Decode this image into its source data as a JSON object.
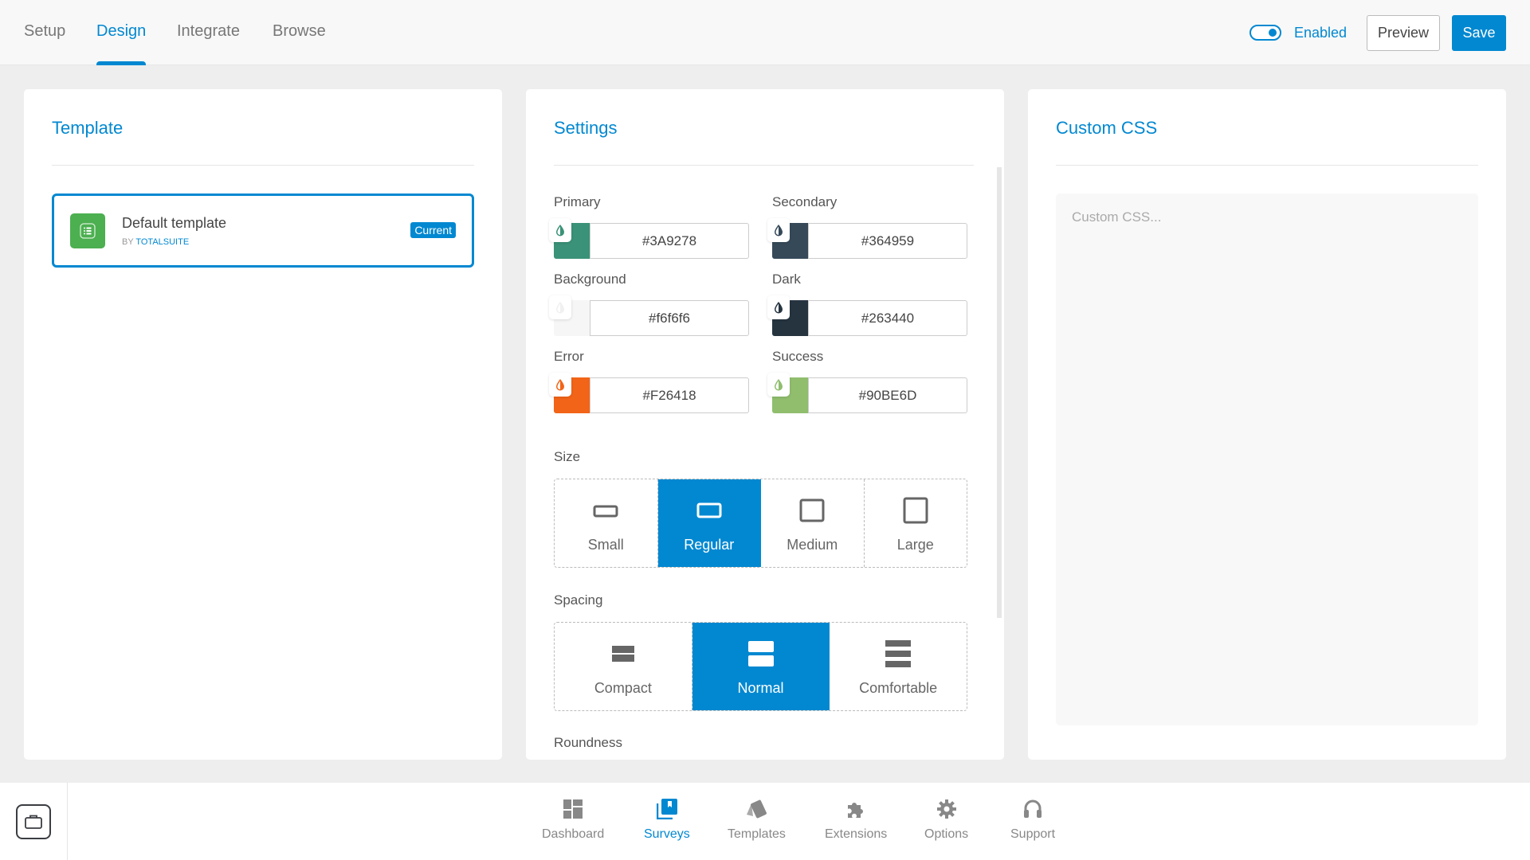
{
  "header": {
    "tabs": [
      {
        "label": "Setup",
        "active": false
      },
      {
        "label": "Design",
        "active": true
      },
      {
        "label": "Integrate",
        "active": false
      },
      {
        "label": "Browse",
        "active": false
      }
    ],
    "enabled_label": "Enabled",
    "enabled": true,
    "preview_label": "Preview",
    "save_label": "Save"
  },
  "template_panel": {
    "title": "Template",
    "item": {
      "name": "Default template",
      "by_prefix": "BY",
      "author": "TOTALSUITE",
      "badge": "Current",
      "icon": "list-icon"
    }
  },
  "settings_panel": {
    "title": "Settings",
    "colors": [
      {
        "label": "Primary",
        "value": "#3A9278",
        "swatch": "#3A9278"
      },
      {
        "label": "Secondary",
        "value": "#364959",
        "swatch": "#364959"
      },
      {
        "label": "Background",
        "value": "#f6f6f6",
        "swatch": "#f6f6f6"
      },
      {
        "label": "Dark",
        "value": "#263440",
        "swatch": "#263440"
      },
      {
        "label": "Error",
        "value": "#F26418",
        "swatch": "#F26418"
      },
      {
        "label": "Success",
        "value": "#90BE6D",
        "swatch": "#90BE6D"
      }
    ],
    "size": {
      "label": "Size",
      "options": [
        {
          "label": "Small",
          "selected": false
        },
        {
          "label": "Regular",
          "selected": true
        },
        {
          "label": "Medium",
          "selected": false
        },
        {
          "label": "Large",
          "selected": false
        }
      ]
    },
    "spacing": {
      "label": "Spacing",
      "options": [
        {
          "label": "Compact",
          "selected": false
        },
        {
          "label": "Normal",
          "selected": true
        },
        {
          "label": "Comfortable",
          "selected": false
        }
      ]
    },
    "roundness": {
      "label": "Roundness"
    }
  },
  "custom_css_panel": {
    "title": "Custom CSS",
    "placeholder": "Custom CSS...",
    "value": ""
  },
  "bottom_nav": {
    "items": [
      {
        "label": "Dashboard",
        "icon": "dashboard-icon",
        "active": false
      },
      {
        "label": "Surveys",
        "icon": "surveys-icon",
        "active": true
      },
      {
        "label": "Templates",
        "icon": "templates-icon",
        "active": false
      },
      {
        "label": "Extensions",
        "icon": "puzzle-icon",
        "active": false
      },
      {
        "label": "Options",
        "icon": "gear-icon",
        "active": false
      },
      {
        "label": "Support",
        "icon": "headphones-icon",
        "active": false
      }
    ]
  },
  "colors": {
    "accent": "#0288d1",
    "template_thumb": "#4caf50"
  }
}
